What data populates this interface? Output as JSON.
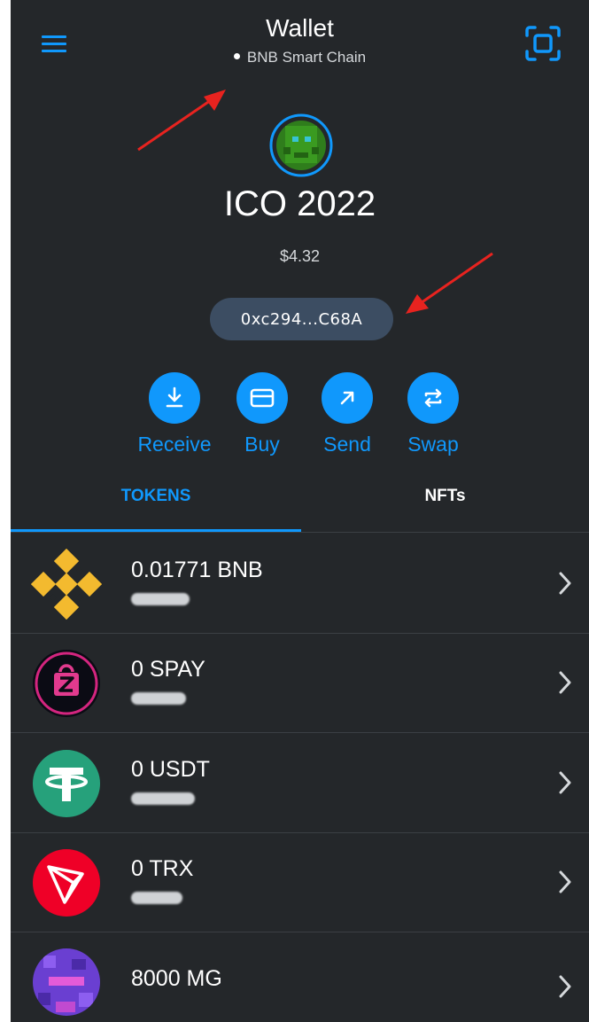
{
  "header": {
    "title": "Wallet",
    "network": "BNB Smart Chain",
    "menu_icon": "hamburger-menu-icon",
    "scan_icon": "qr-scan-icon"
  },
  "account": {
    "name": "ICO 2022",
    "balance": "$4.32",
    "address": "0xc294...C68A",
    "avatar_icon": "identicon-avatar"
  },
  "actions": [
    {
      "label": "Receive",
      "icon": "download-arrow-icon"
    },
    {
      "label": "Buy",
      "icon": "credit-card-icon"
    },
    {
      "label": "Send",
      "icon": "arrow-up-right-icon"
    },
    {
      "label": "Swap",
      "icon": "swap-arrows-icon"
    }
  ],
  "tabs": [
    {
      "label": "TOKENS",
      "active": true
    },
    {
      "label": "NFTs",
      "active": false
    }
  ],
  "tokens": [
    {
      "amount": "0.01771 BNB",
      "fiat": "",
      "icon": "bnb-logo"
    },
    {
      "amount": "0 SPAY",
      "fiat": "",
      "icon": "spay-logo"
    },
    {
      "amount": "0 USDT",
      "fiat": "",
      "icon": "usdt-logo"
    },
    {
      "amount": "0 TRX",
      "fiat": "",
      "icon": "trx-logo"
    },
    {
      "amount": "8000 MG",
      "fiat": "",
      "icon": "mg-logo"
    }
  ],
  "colors": {
    "background": "#24272a",
    "accent": "#1098fc",
    "address_pill": "#3c4d62",
    "annotation_arrow": "#e8231f"
  }
}
